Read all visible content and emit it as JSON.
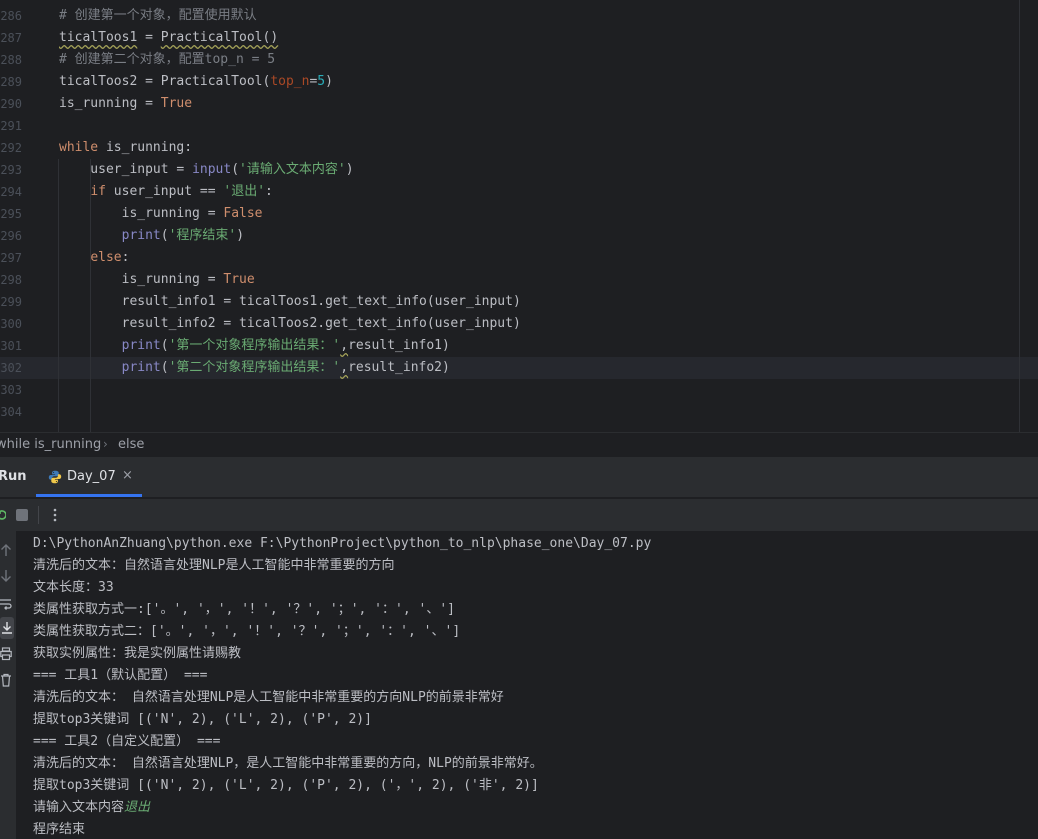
{
  "editor": {
    "lines": [
      {
        "no": "286",
        "tokens": [
          {
            "t": "# 创建第一个对象，配置使用默认",
            "c": "cm"
          }
        ]
      },
      {
        "no": "287",
        "tokens": [
          {
            "t": "ticalToos1",
            "c": "err"
          },
          {
            "t": " = ",
            "c": ""
          },
          {
            "t": "PracticalTool()",
            "c": "err"
          }
        ]
      },
      {
        "no": "288",
        "tokens": [
          {
            "t": "# 创建第二个对象，配置top_n = 5",
            "c": "cm"
          }
        ]
      },
      {
        "no": "289",
        "tokens": [
          {
            "t": "ticalToos2 = PracticalTool(",
            "c": ""
          },
          {
            "t": "top_n",
            "c": "param"
          },
          {
            "t": "=",
            "c": ""
          },
          {
            "t": "5",
            "c": "num"
          },
          {
            "t": ")",
            "c": ""
          }
        ]
      },
      {
        "no": "290",
        "tokens": [
          {
            "t": "is_running = ",
            "c": ""
          },
          {
            "t": "True",
            "c": "kw"
          }
        ]
      },
      {
        "no": "291",
        "tokens": []
      },
      {
        "no": "292",
        "tokens": [
          {
            "t": "while",
            "c": "kw"
          },
          {
            "t": " is_running:",
            "c": ""
          }
        ]
      },
      {
        "no": "293",
        "tokens": [
          {
            "t": "    user_input = ",
            "c": ""
          },
          {
            "t": "input",
            "c": "bi"
          },
          {
            "t": "(",
            "c": ""
          },
          {
            "t": "'请输入文本内容'",
            "c": "str"
          },
          {
            "t": ")",
            "c": ""
          }
        ]
      },
      {
        "no": "294",
        "tokens": [
          {
            "t": "    ",
            "c": ""
          },
          {
            "t": "if",
            "c": "kw"
          },
          {
            "t": " user_input == ",
            "c": ""
          },
          {
            "t": "'退出'",
            "c": "str"
          },
          {
            "t": ":",
            "c": ""
          }
        ]
      },
      {
        "no": "295",
        "tokens": [
          {
            "t": "        is_running = ",
            "c": ""
          },
          {
            "t": "False",
            "c": "kw"
          }
        ]
      },
      {
        "no": "296",
        "tokens": [
          {
            "t": "        ",
            "c": ""
          },
          {
            "t": "print",
            "c": "bi"
          },
          {
            "t": "(",
            "c": ""
          },
          {
            "t": "'程序结束'",
            "c": "str"
          },
          {
            "t": ")",
            "c": ""
          }
        ]
      },
      {
        "no": "297",
        "tokens": [
          {
            "t": "    ",
            "c": ""
          },
          {
            "t": "else",
            "c": "kw"
          },
          {
            "t": ":",
            "c": ""
          }
        ]
      },
      {
        "no": "298",
        "tokens": [
          {
            "t": "        is_running = ",
            "c": ""
          },
          {
            "t": "True",
            "c": "kw"
          }
        ]
      },
      {
        "no": "299",
        "tokens": [
          {
            "t": "        result_info1 = ticalToos1.get_text_info(user_input)",
            "c": ""
          }
        ]
      },
      {
        "no": "300",
        "tokens": [
          {
            "t": "        result_info2 = ticalToos2.get_text_info(user_input)",
            "c": ""
          }
        ]
      },
      {
        "no": "301",
        "tokens": [
          {
            "t": "        ",
            "c": ""
          },
          {
            "t": "print",
            "c": "bi"
          },
          {
            "t": "(",
            "c": ""
          },
          {
            "t": "'第一个对象程序输出结果：'",
            "c": "str"
          },
          {
            "t": ",",
            "c": "match"
          },
          {
            "t": "result_info1)",
            "c": ""
          }
        ]
      },
      {
        "no": "302",
        "tokens": [
          {
            "t": "        ",
            "c": ""
          },
          {
            "t": "print",
            "c": "bi"
          },
          {
            "t": "(",
            "c": ""
          },
          {
            "t": "'第二个对象程序输出结果：'",
            "c": "str"
          },
          {
            "t": ",",
            "c": "match"
          },
          {
            "t": "result_info2)",
            "c": ""
          }
        ]
      },
      {
        "no": "303",
        "tokens": []
      },
      {
        "no": "304",
        "tokens": []
      }
    ]
  },
  "breadcrumb": {
    "items": [
      "while is_running",
      "else"
    ],
    "separator": "›"
  },
  "run_panel": {
    "title": "Run",
    "tab_label": "Day_07",
    "close_glyph": "×"
  },
  "console": {
    "lines": [
      {
        "text": "D:\\PythonAnZhuang\\python.exe F:\\PythonProject\\python_to_nlp\\phase_one\\Day_07.py"
      },
      {
        "text": "清洗后的文本：自然语言处理NLP是人工智能中非常重要的方向"
      },
      {
        "text": "文本长度：33"
      },
      {
        "text": "类属性获取方式一:['。', '，', '！', '？', '；', '：', '、']"
      },
      {
        "text": "类属性获取方式二：['。', '，', '！', '？', '；', '：', '、']"
      },
      {
        "text": "获取实例属性：我是实例属性请赐教"
      },
      {
        "text": "=== 工具1（默认配置） ==="
      },
      {
        "text": "清洗后的文本： 自然语言处理NLP是人工智能中非常重要的方向NLP的前景非常好"
      },
      {
        "text": "提取top3关键词 [('N', 2), ('L', 2), ('P', 2)]"
      },
      {
        "text": "=== 工具2（自定义配置） ==="
      },
      {
        "text": "清洗后的文本： 自然语言处理NLP，是人工智能中非常重要的方向，NLP的前景非常好。"
      },
      {
        "text": "提取top3关键词 [('N', 2), ('L', 2), ('P', 2), ('，', 2), ('非', 2)]"
      },
      {
        "text": "请输入文本内容",
        "input": "退出"
      },
      {
        "text": "程序结束"
      }
    ]
  },
  "colors": {
    "background": "#1e1f22",
    "panel": "#2b2d30",
    "keyword": "#cf8e6d",
    "string": "#6aab73",
    "comment": "#7a7e85",
    "builtin": "#8888c6",
    "number": "#2aacb8",
    "accent": "#3574f0"
  }
}
